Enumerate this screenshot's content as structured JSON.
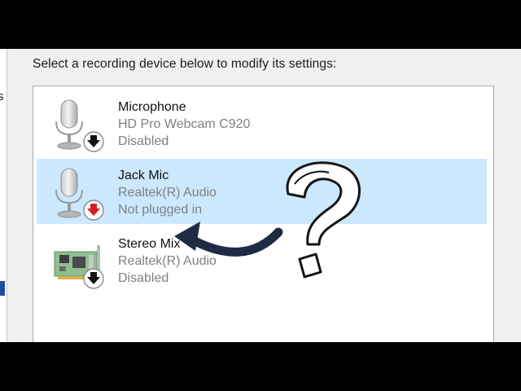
{
  "window": {
    "left_fragment": "s",
    "instruction": "Select a recording device below to modify its settings:"
  },
  "devices": [
    {
      "name": "Microphone",
      "driver": "HD Pro Webcam C920",
      "status": "Disabled",
      "icon": "microphone-icon",
      "badge": "disabled-arrow-badge",
      "selected": false
    },
    {
      "name": "Jack Mic",
      "driver": "Realtek(R) Audio",
      "status": "Not plugged in",
      "icon": "microphone-icon",
      "badge": "unplugged-arrow-badge",
      "selected": true
    },
    {
      "name": "Stereo Mix",
      "driver": "Realtek(R) Audio",
      "status": "Disabled",
      "icon": "sound-card-icon",
      "badge": "disabled-arrow-badge",
      "selected": false
    }
  ],
  "colors": {
    "selection": "#cce8ff",
    "annotation_arrow": "#1f2a44",
    "unplugged_badge_arrow": "#d81b1b"
  },
  "overlay": {
    "arrow_icon": "curved-arrow-icon",
    "question_icon": "question-mark-icon"
  }
}
